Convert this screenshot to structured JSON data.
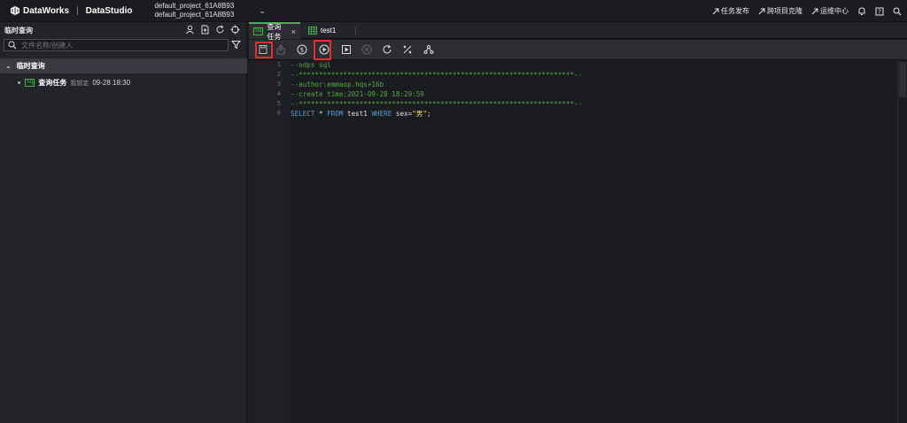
{
  "header": {
    "brand": "DataWorks",
    "product": "DataStudio",
    "project_line1": "default_project_61A8B93",
    "project_line2": "default_project_61A8B93",
    "links": [
      "任务发布",
      "跨项目克隆",
      "运维中心"
    ]
  },
  "sidebar": {
    "title": "临时查询",
    "search_placeholder": "文件名称/创建人",
    "folder_label": "临时查询",
    "item": {
      "badge": "Sq",
      "name": "查询任务",
      "owner": "我锁定",
      "time": "09-28 18:30"
    }
  },
  "tabs": [
    {
      "badge": "Sq",
      "label": "查询任务",
      "close": "×"
    },
    {
      "label": "test1"
    }
  ],
  "toolbar_icons": [
    "save-icon",
    "commit-icon",
    "cost-estimate-icon",
    "run-icon",
    "run-with-params-icon",
    "stop-icon",
    "refresh-icon",
    "format-icon",
    "lineage-icon"
  ],
  "editor": {
    "line_numbers": [
      "1",
      "2",
      "3",
      "4",
      "5",
      "6"
    ],
    "line1": "--odps sql",
    "line2": "--********************************************************************--",
    "line3": "--author:emmaop.hqs+16b",
    "line4": "--create time:2021-09-28 18:29:59",
    "line5": "--********************************************************************--",
    "line6_kw1": "SELECT",
    "line6_star": " * ",
    "line6_kw2": "FROM",
    "line6_tbl": " test1 ",
    "line6_kw3": "WHERE",
    "line6_cond": " sex=",
    "line6_str": "\"男\"",
    "line6_end": ";"
  },
  "colors": {
    "accent": "#4caf50",
    "highlight": "#e52e2e",
    "background": "#1b1c20"
  }
}
